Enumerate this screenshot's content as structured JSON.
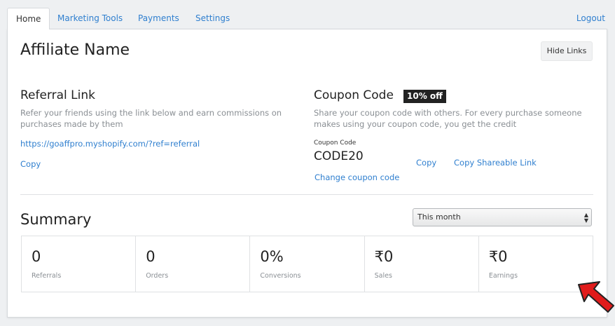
{
  "tabs": [
    {
      "label": "Home",
      "active": true
    },
    {
      "label": "Marketing Tools"
    },
    {
      "label": "Payments"
    },
    {
      "label": "Settings"
    }
  ],
  "logout_label": "Logout",
  "affiliate_name": "Affiliate Name",
  "hide_links_label": "Hide Links",
  "referral": {
    "title": "Referral Link",
    "description": "Refer your friends using the link below and earn commissions on purchases made by them",
    "url": "https://goaffpro.myshopify.com/?ref=referral",
    "copy_label": "Copy"
  },
  "coupon": {
    "title": "Coupon Code",
    "badge": "10% off",
    "description": "Share your coupon code with others. For every purchase someone makes using your coupon code, you get the credit",
    "code_label": "Coupon Code",
    "code": "CODE20",
    "copy_label": "Copy",
    "share_label": "Copy Shareable Link",
    "change_label": "Change coupon code"
  },
  "summary": {
    "title": "Summary",
    "period_selected": "This month",
    "stats": [
      {
        "value": "0",
        "label": "Referrals"
      },
      {
        "value": "0",
        "label": "Orders"
      },
      {
        "value": "0%",
        "label": "Conversions"
      },
      {
        "value": "₹0",
        "label": "Sales"
      },
      {
        "value": "₹0",
        "label": "Earnings"
      }
    ]
  },
  "colors": {
    "link": "#2f7fcf",
    "badge_bg": "#222222",
    "arrow": "#e01b1b"
  },
  "icons": {
    "select": "up-down-arrows-icon",
    "annotation": "red-pointer-arrow-icon"
  }
}
